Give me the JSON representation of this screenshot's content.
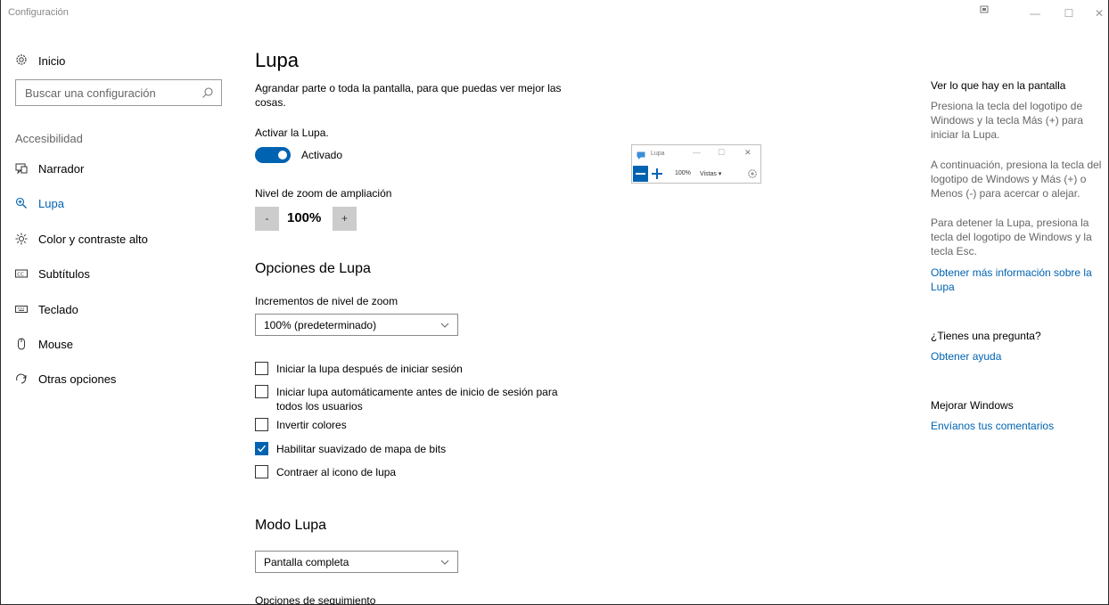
{
  "window": {
    "title": "Configuración",
    "controls": {
      "minimize": "—",
      "maximize": "☐",
      "close": "✕"
    }
  },
  "sidebar": {
    "home": {
      "label": "Inicio",
      "icon": "gear-icon"
    },
    "search": {
      "placeholder": "Buscar una configuración",
      "icon": "search-icon"
    },
    "section_label": "Accesibilidad",
    "items": [
      {
        "label": "Narrador",
        "icon": "narrator-icon",
        "active": false
      },
      {
        "label": "Lupa",
        "icon": "magnifier-icon",
        "active": true
      },
      {
        "label": "Color y contraste alto",
        "icon": "brightness-icon",
        "active": false
      },
      {
        "label": "Subtítulos",
        "icon": "closed-captions-icon",
        "active": false
      },
      {
        "label": "Teclado",
        "icon": "keyboard-icon",
        "active": false
      },
      {
        "label": "Mouse",
        "icon": "mouse-icon",
        "active": false
      },
      {
        "label": "Otras opciones",
        "icon": "other-options-icon",
        "active": false
      }
    ]
  },
  "main": {
    "title": "Lupa",
    "description": "Agrandar parte o toda la pantalla, para que puedas ver mejor las cosas.",
    "activate": {
      "label": "Activar la Lupa.",
      "state_label": "Activado",
      "on": true
    },
    "zoom": {
      "label": "Nivel de zoom de ampliación",
      "minus": "-",
      "value": "100%",
      "plus": "+"
    },
    "options": {
      "title": "Opciones de Lupa",
      "increments_label": "Incrementos de nivel de zoom",
      "increments_value": "100% (predeterminado)",
      "checkboxes": [
        {
          "label": "Iniciar la lupa después de iniciar sesión",
          "checked": false
        },
        {
          "label": "Iniciar lupa automáticamente antes de inicio de sesión para todos los usuarios",
          "checked": false
        },
        {
          "label": "Invertir colores",
          "checked": false
        },
        {
          "label": "Habilitar suavizado de mapa de bits",
          "checked": true
        },
        {
          "label": "Contraer al icono de lupa",
          "checked": false
        }
      ]
    },
    "mode": {
      "title": "Modo Lupa",
      "value": "Pantalla completa",
      "tracking_label": "Opciones de seguimiento"
    }
  },
  "magnifier_window": {
    "title": "Lupa",
    "zoom": "100%",
    "views": "Vistas ▾",
    "controls": {
      "minimize": "—",
      "maximize": "☐",
      "close": "✕"
    }
  },
  "aside": {
    "section1": {
      "title": "Ver lo que hay en la pantalla",
      "p1": "Presiona la tecla del logotipo de Windows y la tecla Más (+) para iniciar la Lupa.",
      "p2": "A continuación, presiona la tecla del logotipo de Windows y Más (+) o Menos (-) para acercar o alejar.",
      "p3": "Para detener la Lupa, presiona la tecla del logotipo de Windows y la tecla Esc.",
      "link": "Obtener más información sobre la Lupa"
    },
    "section2": {
      "title": "¿Tienes una pregunta?",
      "link": "Obtener ayuda"
    },
    "section3": {
      "title": "Mejorar Windows",
      "link": "Envíanos tus comentarios"
    }
  },
  "colors": {
    "accent": "#0063b1",
    "muted_text": "#666666",
    "control_gray": "#cccccc"
  }
}
